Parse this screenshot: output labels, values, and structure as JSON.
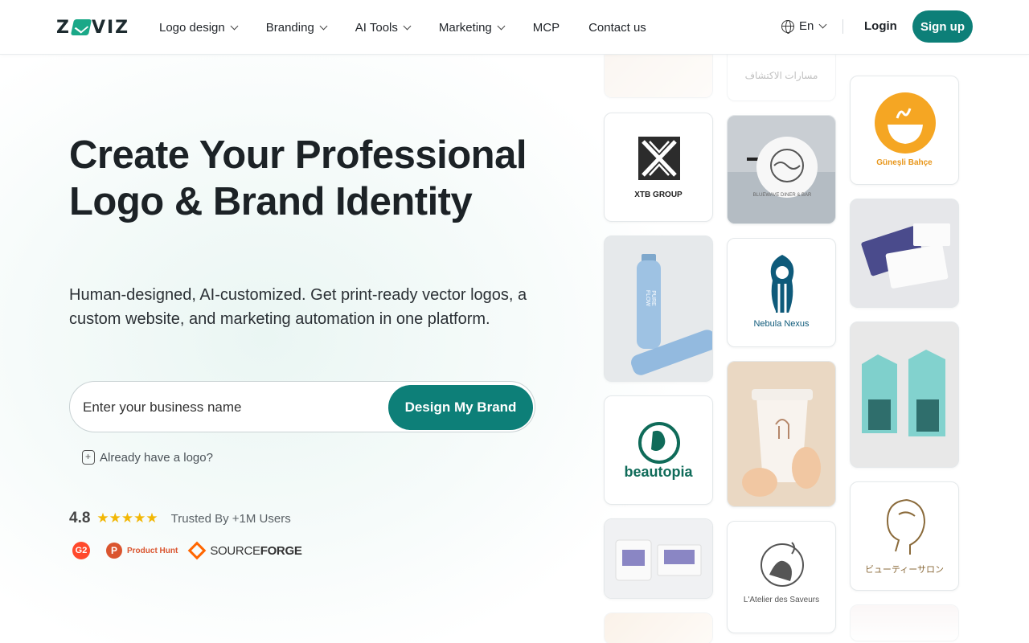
{
  "header": {
    "logo_text_left": "Z",
    "logo_text_right": "VIZ",
    "nav": [
      {
        "label": "Logo design",
        "dropdown": true
      },
      {
        "label": "Branding",
        "dropdown": true
      },
      {
        "label": "AI Tools",
        "dropdown": true
      },
      {
        "label": "Marketing",
        "dropdown": true
      },
      {
        "label": "MCP",
        "dropdown": false
      },
      {
        "label": "Contact us",
        "dropdown": false
      }
    ],
    "language": "En",
    "login": "Login",
    "signup": "Sign up"
  },
  "hero": {
    "title": "Create Your Professional Logo & Brand Identity",
    "subtitle": "Human-designed, AI-customized. Get print-ready vector logos, a custom website, and marketing automation in one platform.",
    "search_placeholder": "Enter your business name",
    "cta": "Design My Brand",
    "already_logo": "Already have a logo?",
    "rating": "4.8",
    "stars": "★★★★★",
    "trusted": "Trusted By +1M Users",
    "badges": {
      "g2": "G2",
      "producthunt": "Product Hunt",
      "sourceforge_a": "SOURCE",
      "sourceforge_b": "FORGE"
    }
  },
  "gallery": {
    "xtb": "XTB GROUP",
    "nebula": "Nebula Nexus",
    "beautopia": "beautopia",
    "gunesli": "Güneşli Bahçe",
    "arabic": "مسارات الاكتشاف",
    "japanese": "ビューティーサロン",
    "atelier": "L'Atelier des Saveurs",
    "bottle": "PURE FLOW",
    "blueware": "BLUEWAVE DINER & BAR"
  },
  "colors": {
    "accent": "#0d7f78",
    "brand_mark": "#1aa888",
    "star": "#f2b705"
  }
}
